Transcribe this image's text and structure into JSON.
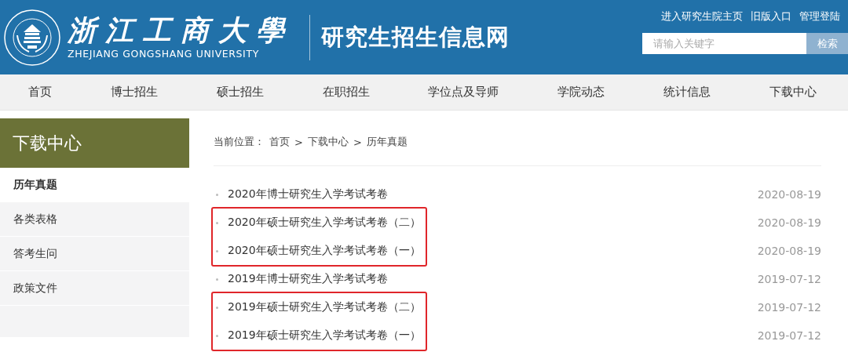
{
  "header": {
    "logo_name": "浙江工商大學",
    "logo_english": "ZHEJIANG GONGSHANG UNIVERSITY",
    "site_title": "研究生招生信息网",
    "links": [
      "进入研究生院主页",
      "旧版入口",
      "管理登陆"
    ],
    "search": {
      "placeholder": "请输入关键字",
      "button": "检索"
    }
  },
  "nav": [
    "首页",
    "博士招生",
    "硕士招生",
    "在职招生",
    "学位点及导师",
    "学院动态",
    "统计信息",
    "下载中心"
  ],
  "sidebar": {
    "title": "下载中心",
    "items": [
      {
        "label": "历年真题",
        "selected": true
      },
      {
        "label": "各类表格",
        "selected": false
      },
      {
        "label": "答考生问",
        "selected": false
      },
      {
        "label": "政策文件",
        "selected": false
      }
    ]
  },
  "breadcrumb": {
    "prefix": "当前位置：",
    "items": [
      "首页",
      "下载中心",
      "历年真题"
    ],
    "separator": ">"
  },
  "groups": [
    {
      "highlighted": false,
      "items": [
        {
          "title": "2020年博士研究生入学考试考卷",
          "date": "2020-08-19"
        }
      ]
    },
    {
      "highlighted": true,
      "items": [
        {
          "title": "2020年硕士研究生入学考试考卷（二）",
          "date": "2020-08-19"
        },
        {
          "title": "2020年硕士研究生入学考试考卷（一）",
          "date": "2020-08-19"
        }
      ]
    },
    {
      "highlighted": false,
      "items": [
        {
          "title": "2019年博士研究生入学考试考卷",
          "date": "2019-07-12"
        }
      ]
    },
    {
      "highlighted": true,
      "items": [
        {
          "title": "2019年硕士研究生入学考试考卷（二）",
          "date": "2019-07-12"
        },
        {
          "title": "2019年硕士研究生入学考试考卷（一）",
          "date": "2019-07-12"
        }
      ]
    }
  ]
}
